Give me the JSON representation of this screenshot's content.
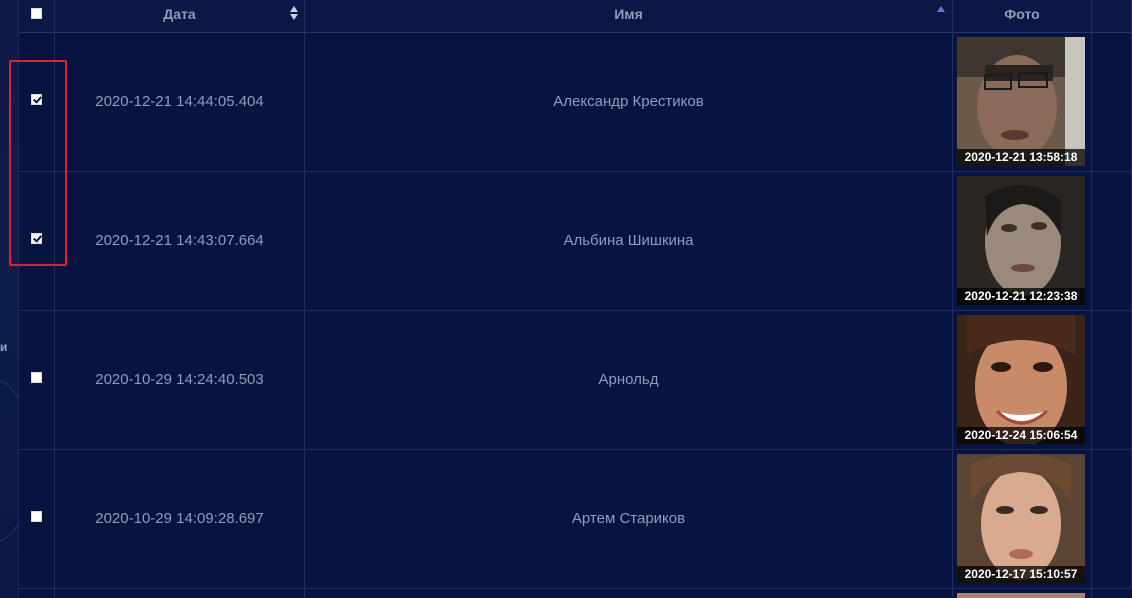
{
  "side": {
    "label": "и"
  },
  "table": {
    "headers": {
      "date": "Дата",
      "name": "Имя",
      "photo": "Фото"
    },
    "rows": [
      {
        "checked": true,
        "date": "2020-12-21 14:44:05.404",
        "name": "Александр Крестиков",
        "photo_time": "2020-12-21 13:58:18"
      },
      {
        "checked": true,
        "date": "2020-12-21 14:43:07.664",
        "name": "Альбина Шишкина",
        "photo_time": "2020-12-21 12:23:38"
      },
      {
        "checked": false,
        "date": "2020-10-29 14:24:40.503",
        "name": "Арнольд",
        "photo_time": "2020-12-24 15:06:54"
      },
      {
        "checked": false,
        "date": "2020-10-29 14:09:28.697",
        "name": "Артем Стариков",
        "photo_time": "2020-12-17 15:10:57"
      }
    ]
  },
  "colors": {
    "background": "#071440",
    "highlight": "#e0202a",
    "sort_active": "#5b78d6"
  }
}
